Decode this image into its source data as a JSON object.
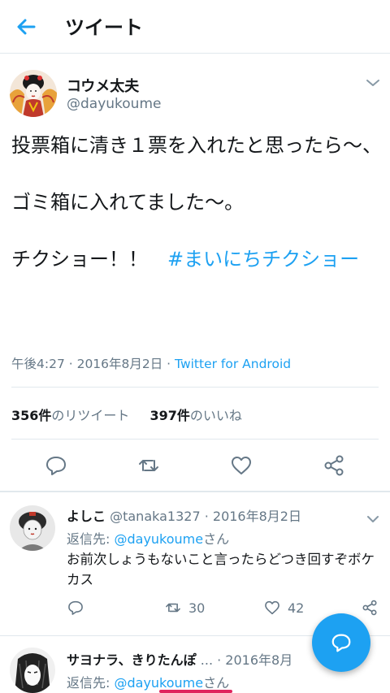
{
  "header": {
    "title": "ツイート"
  },
  "tweet": {
    "author_name": "コウメ太夫",
    "author_handle": "@dayukoume",
    "text_body": "投票箱に清き１票を入れたと思ったら〜、\n\nゴミ箱に入れてました〜。\n\nチクショー！！　",
    "hashtag": "#まいにちチクショー",
    "time": "午後4:27 · 2016年8月2日 · ",
    "source": "Twitter for Android",
    "retweets_count": "356件",
    "retweets_label": "のリツイート",
    "likes_count": "397件",
    "likes_label": "のいいね"
  },
  "replies": [
    {
      "name": "よしこ",
      "handle_date": " @tanaka1327 · 2016年8月2日",
      "reply_prefix": "返信先: ",
      "reply_mention": "@dayukoume",
      "reply_suffix": "さん",
      "text": "お前次しょうもないこと言ったらどつき回すぞボケカス",
      "retweets": "30",
      "likes": "42"
    },
    {
      "name": "サヨナラ、きりたんぽ",
      "handle_date": " ... · 2016年8月",
      "reply_prefix": "返信先: ",
      "reply_mention": "@dayukoume",
      "reply_suffix": "さん"
    }
  ],
  "colors": {
    "accent": "#1da1f2",
    "secondary_text": "#657786",
    "divider": "#e1e8ed",
    "highlight": "#e0245e"
  },
  "icons": [
    "back-arrow-icon",
    "chevron-down-icon",
    "reply-icon",
    "retweet-icon",
    "like-icon",
    "share-icon",
    "compose-icon"
  ]
}
